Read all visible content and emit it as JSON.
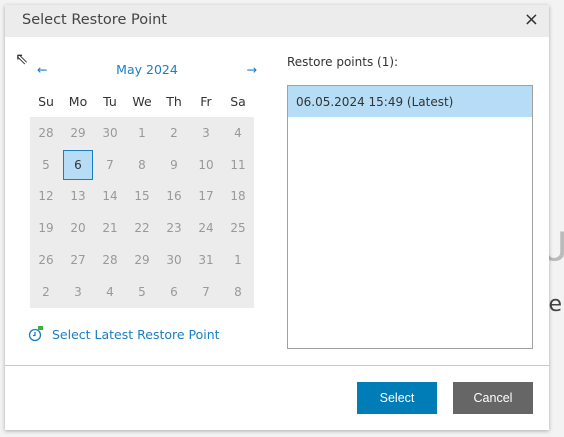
{
  "dialog": {
    "title": "Select Restore Point",
    "close_icon": "×"
  },
  "calendar": {
    "prev": "←",
    "next": "→",
    "month": "May 2024",
    "weekdays": [
      "Su",
      "Mo",
      "Tu",
      "We",
      "Th",
      "Fr",
      "Sa"
    ],
    "days": [
      "28",
      "29",
      "30",
      "1",
      "2",
      "3",
      "4",
      "5",
      "6",
      "7",
      "8",
      "9",
      "10",
      "11",
      "12",
      "13",
      "14",
      "15",
      "16",
      "17",
      "18",
      "19",
      "20",
      "21",
      "22",
      "23",
      "24",
      "25",
      "26",
      "27",
      "28",
      "29",
      "30",
      "31",
      "1",
      "2",
      "3",
      "4",
      "5",
      "6",
      "7",
      "8"
    ],
    "selected": "6"
  },
  "latest_link": "Select Latest Restore Point",
  "restore_points": {
    "label": "Restore points (1):",
    "items": [
      "06.05.2024 15:49 (Latest)"
    ]
  },
  "buttons": {
    "select": "Select",
    "cancel": "Cancel"
  },
  "background": {
    "text": "re"
  },
  "colors": {
    "accent": "#007cb7",
    "selection": "#b6ddf5",
    "cancel": "#666666"
  }
}
